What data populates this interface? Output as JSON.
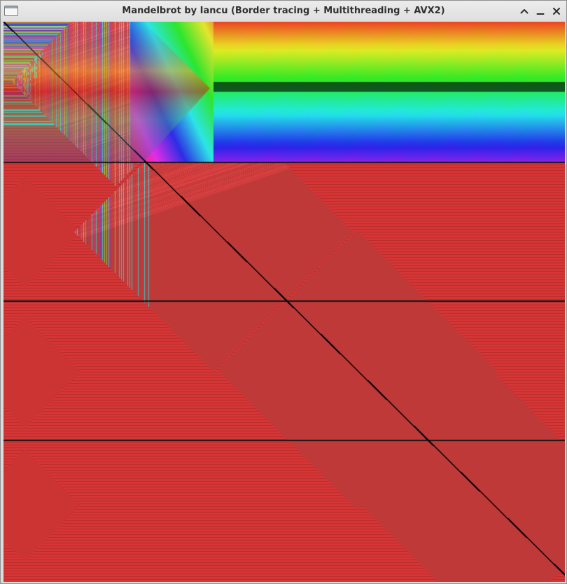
{
  "window": {
    "title": "Mandelbrot by Iancu (Border tracing + Multithreading + AVX2)",
    "controls": {
      "maximize_icon": "chevron-up-icon",
      "minimize_icon": "minimize-icon",
      "close_icon": "close-icon"
    }
  },
  "render": {
    "subject": "fractal-render-area",
    "dominant_colors": [
      "#e0432a",
      "#f5a623",
      "#36c98a",
      "#2f6fd6",
      "#8a3fd1",
      "#d24fb0",
      "#000000"
    ]
  }
}
